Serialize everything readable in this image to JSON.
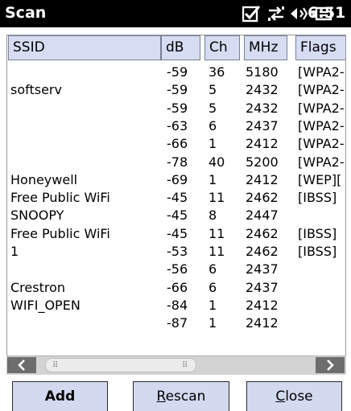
{
  "app": {
    "title": "Scan",
    "time": "6:51"
  },
  "status_icons": [
    "checkbox-icon",
    "sync-arrows-icon",
    "volume-icon",
    "battery-icon"
  ],
  "table": {
    "columns": [
      "SSID",
      "dB",
      "Ch",
      "MHz",
      "Flags"
    ],
    "rows": [
      {
        "ssid": "",
        "db": "-59",
        "ch": "36",
        "mhz": "5180",
        "flags": "[WPA2-"
      },
      {
        "ssid": "softserv",
        "db": "-59",
        "ch": "5",
        "mhz": "2432",
        "flags": "[WPA2-"
      },
      {
        "ssid": "",
        "db": "-59",
        "ch": "5",
        "mhz": "2432",
        "flags": "[WPA2-"
      },
      {
        "ssid": "",
        "db": "-63",
        "ch": "6",
        "mhz": "2437",
        "flags": "[WPA2-"
      },
      {
        "ssid": "",
        "db": "-66",
        "ch": "1",
        "mhz": "2412",
        "flags": "[WPA2-"
      },
      {
        "ssid": "",
        "db": "-78",
        "ch": "40",
        "mhz": "5200",
        "flags": "[WPA2-"
      },
      {
        "ssid": "Honeywell",
        "db": "-69",
        "ch": "1",
        "mhz": "2412",
        "flags": "[WEP]["
      },
      {
        "ssid": "Free Public WiFi",
        "db": "-45",
        "ch": "11",
        "mhz": "2462",
        "flags": "[IBSS]"
      },
      {
        "ssid": "SNOOPY",
        "db": "-45",
        "ch": "8",
        "mhz": "2447",
        "flags": ""
      },
      {
        "ssid": "Free Public WiFi",
        "db": "-45",
        "ch": "11",
        "mhz": "2462",
        "flags": "[IBSS]"
      },
      {
        "ssid": "1",
        "db": "-53",
        "ch": "11",
        "mhz": "2462",
        "flags": "[IBSS]"
      },
      {
        "ssid": "",
        "db": "-56",
        "ch": "6",
        "mhz": "2437",
        "flags": ""
      },
      {
        "ssid": "Crestron",
        "db": "-66",
        "ch": "6",
        "mhz": "2437",
        "flags": ""
      },
      {
        "ssid": "WIFI_OPEN",
        "db": "-84",
        "ch": "1",
        "mhz": "2412",
        "flags": ""
      },
      {
        "ssid": "",
        "db": "-87",
        "ch": "1",
        "mhz": "2412",
        "flags": ""
      }
    ]
  },
  "scrollbar": {
    "left_icon": "chevron-left-icon",
    "right_icon": "chevron-right-icon"
  },
  "buttons": {
    "add": {
      "label": "Add"
    },
    "rescan": {
      "label": "Rescan",
      "access_key": "R",
      "rest": "escan"
    },
    "close": {
      "label": "Close",
      "access_key": "C",
      "rest": "lose"
    }
  }
}
